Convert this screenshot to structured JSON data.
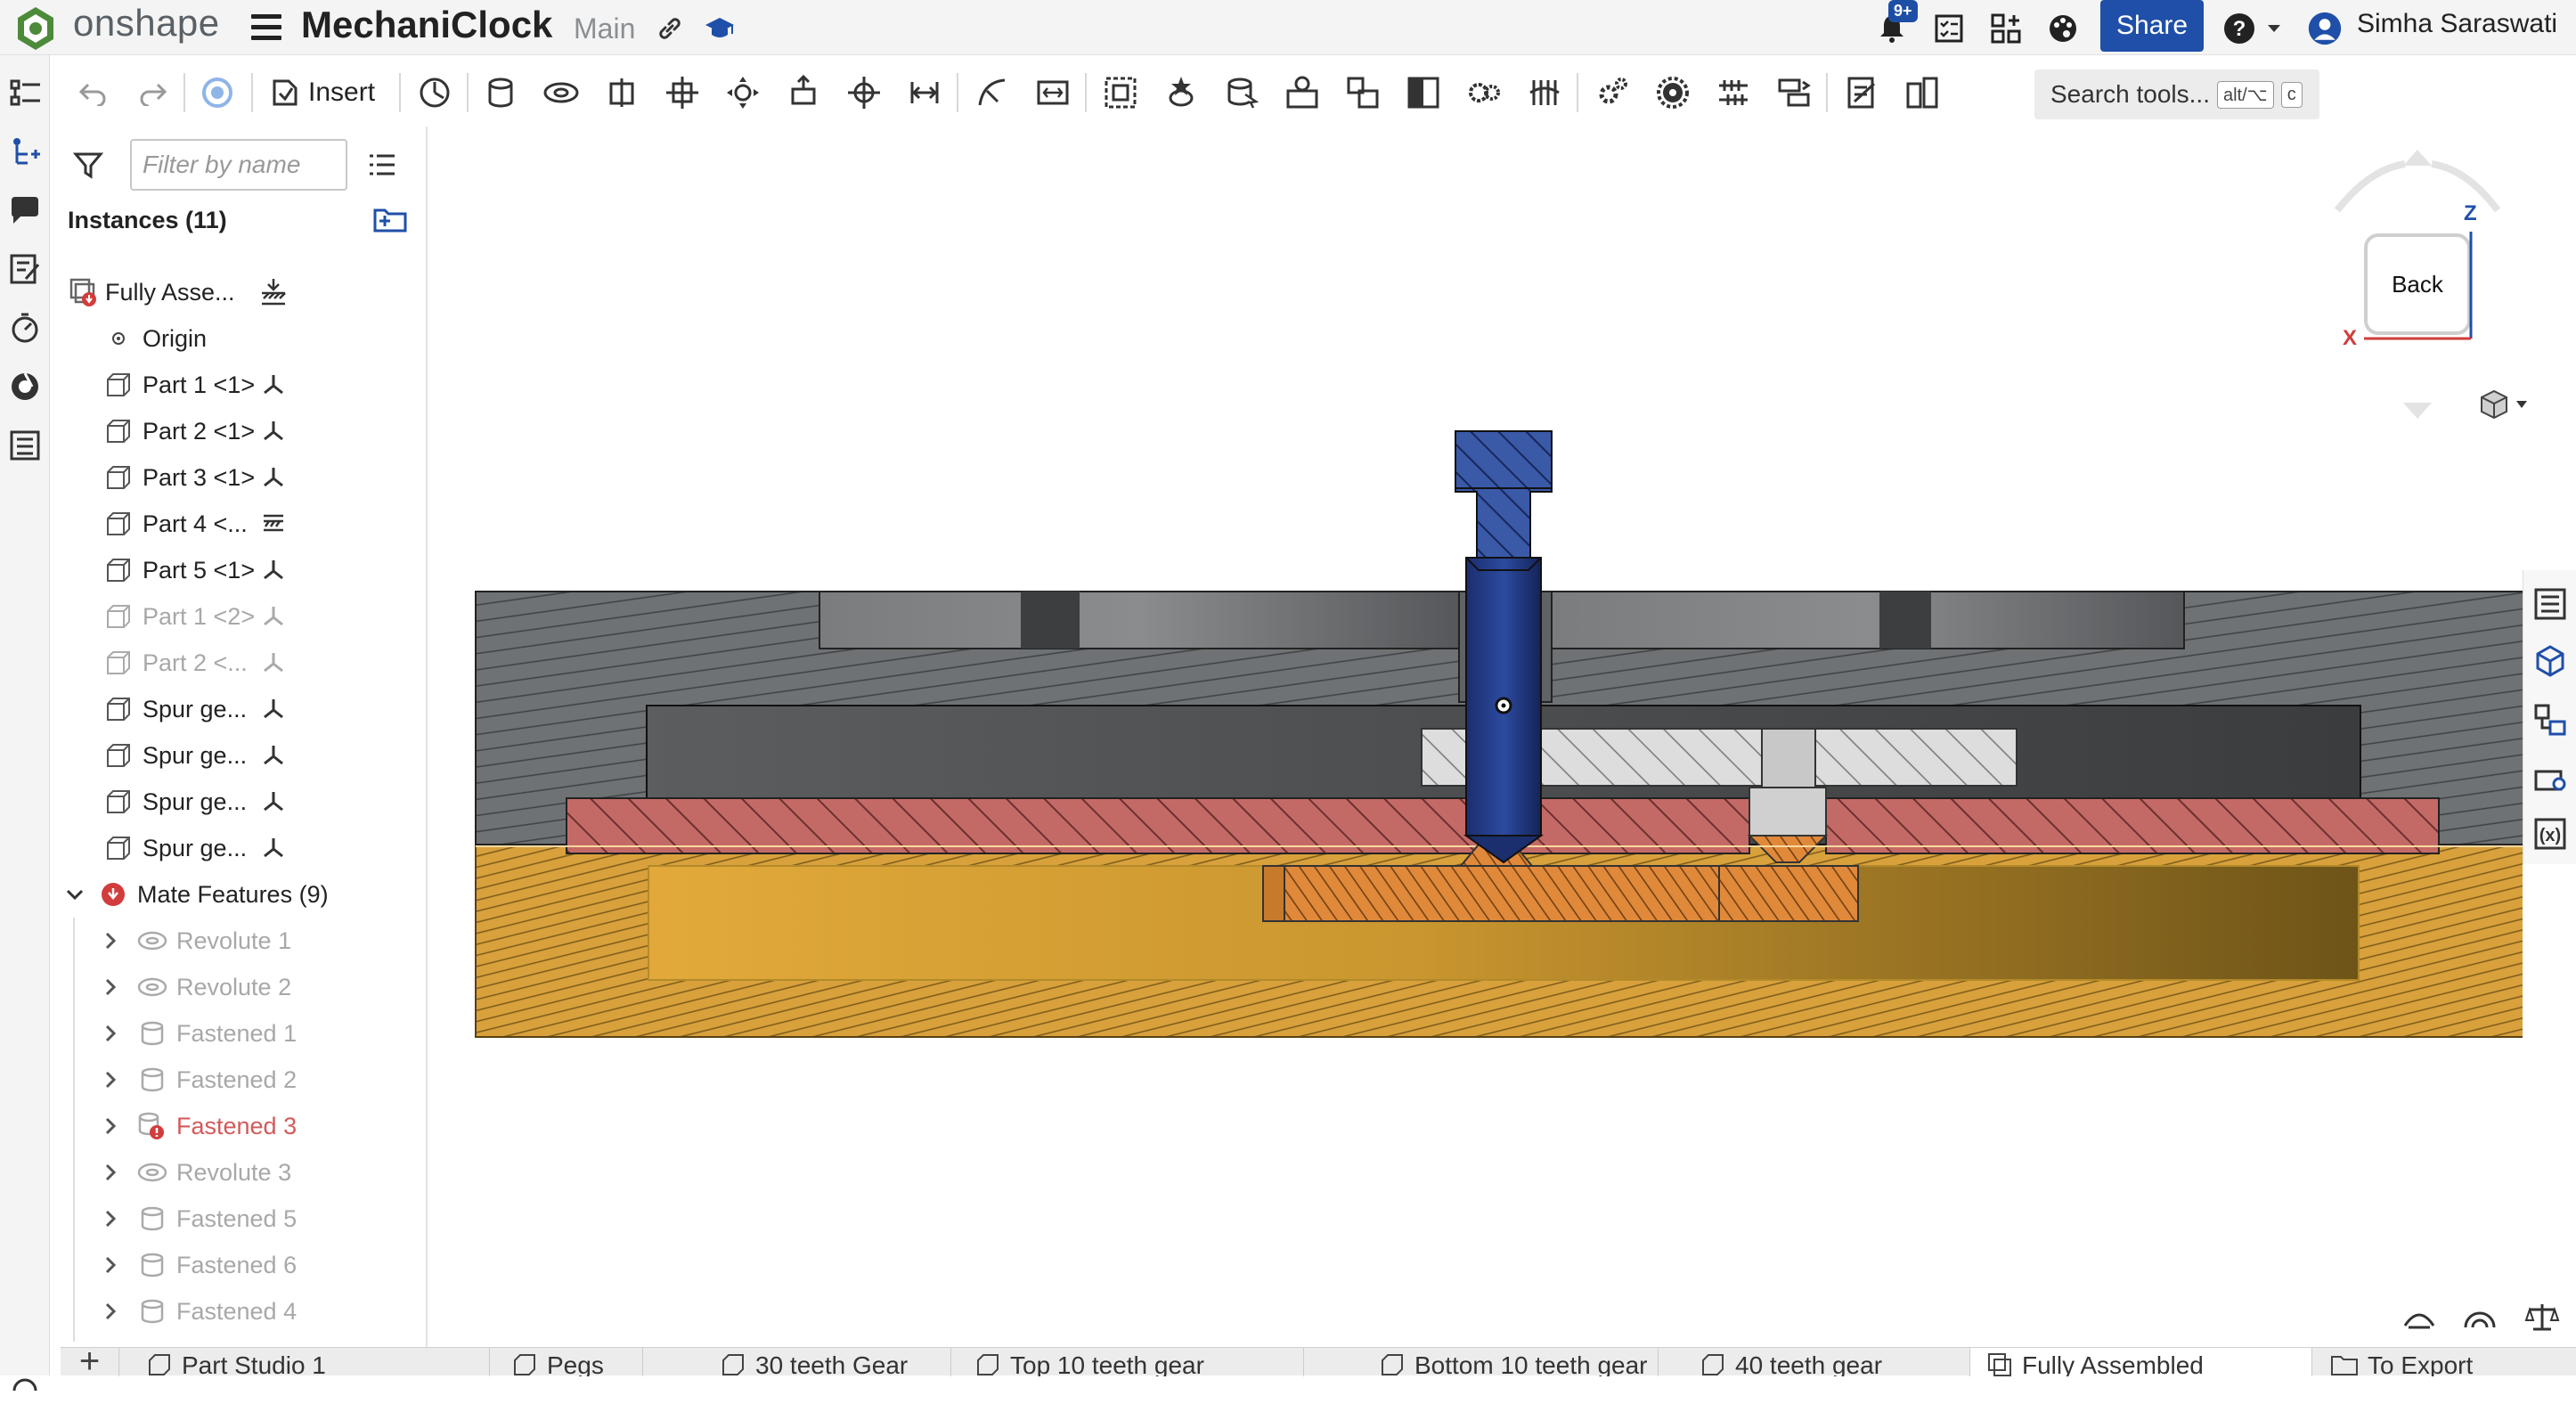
{
  "app": {
    "logo_text": "onshape",
    "doc_title": "MechaniClock",
    "branch": "Main",
    "notification_badge": "9+",
    "share_label": "Share",
    "user_name": "Simha Saraswati",
    "accent": "#1f4fa8"
  },
  "toolbar": {
    "insert_label": "Insert",
    "search_placeholder": "Search tools...",
    "search_shortcut_1": "alt/⌥",
    "search_shortcut_2": "c"
  },
  "panel": {
    "filter_placeholder": "Filter by name",
    "instances_heading": "Instances (11)",
    "instances": [
      {
        "label": "Fully Asse...",
        "state": "normal"
      },
      {
        "label": "Origin",
        "state": "normal"
      },
      {
        "label": "Part 1 <1>",
        "state": "normal"
      },
      {
        "label": "Part 2 <1>",
        "state": "normal"
      },
      {
        "label": "Part 3 <1>",
        "state": "normal"
      },
      {
        "label": "Part 4 <...",
        "state": "normal"
      },
      {
        "label": "Part 5 <1>",
        "state": "normal"
      },
      {
        "label": "Part 1 <2>",
        "state": "dim"
      },
      {
        "label": "Part 2 <...",
        "state": "dim"
      },
      {
        "label": "Spur ge...",
        "state": "normal"
      },
      {
        "label": "Spur ge...",
        "state": "normal"
      },
      {
        "label": "Spur ge...",
        "state": "normal"
      },
      {
        "label": "Spur ge...",
        "state": "normal"
      }
    ],
    "mate_heading": "Mate Features (9)",
    "mates": [
      {
        "label": "Revolute 1",
        "kind": "revolute",
        "state": "dim"
      },
      {
        "label": "Revolute 2",
        "kind": "revolute",
        "state": "dim"
      },
      {
        "label": "Fastened 1",
        "kind": "fastened",
        "state": "dim"
      },
      {
        "label": "Fastened 2",
        "kind": "fastened",
        "state": "dim"
      },
      {
        "label": "Fastened 3",
        "kind": "fastened",
        "state": "err"
      },
      {
        "label": "Revolute 3",
        "kind": "revolute",
        "state": "dim"
      },
      {
        "label": "Fastened 5",
        "kind": "fastened",
        "state": "dim"
      },
      {
        "label": "Fastened 6",
        "kind": "fastened",
        "state": "dim"
      },
      {
        "label": "Fastened 4",
        "kind": "fastened",
        "state": "dim"
      }
    ]
  },
  "viewcube": {
    "face_label": "Back",
    "axis_z": "Z",
    "axis_x": "X"
  },
  "tabs": [
    {
      "label": "Part Studio 1",
      "active": false
    },
    {
      "label": "Pegs",
      "active": false
    },
    {
      "label": "30 teeth Gear",
      "active": false
    },
    {
      "label": "Top 10 teeth gear",
      "active": false
    },
    {
      "label": "Bottom 10 teeth gear",
      "active": false
    },
    {
      "label": "40 teeth gear",
      "active": false
    },
    {
      "label": "Fully Assembled",
      "active": true
    },
    {
      "label": "To Export",
      "active": false
    }
  ]
}
